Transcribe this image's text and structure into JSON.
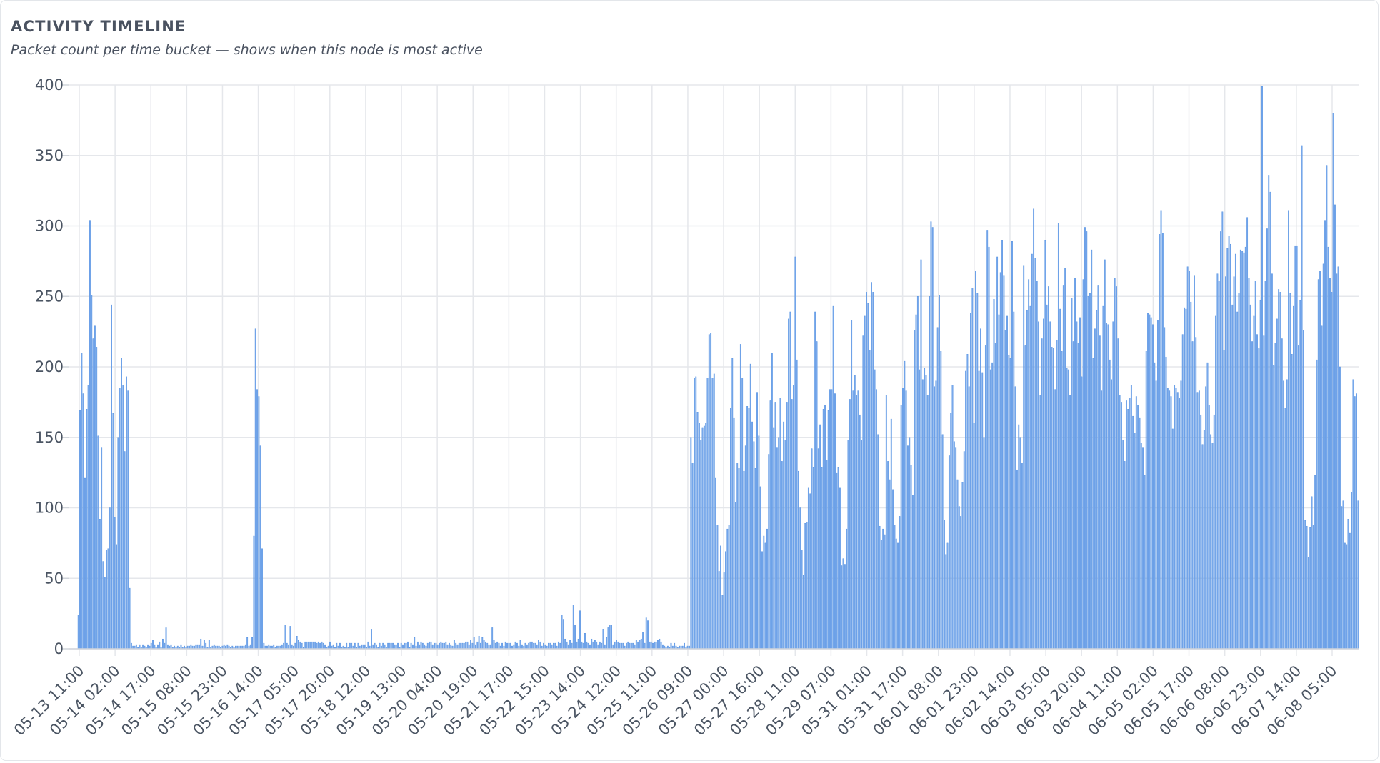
{
  "panel": {
    "title": "ACTIVITY TIMELINE",
    "subtitle": "Packet count per time bucket — shows when this node is most active"
  },
  "chart_data": {
    "type": "bar",
    "title": "ACTIVITY TIMELINE",
    "subtitle": "Packet count per time bucket — shows when this node is most active",
    "xlabel": "",
    "ylabel": "",
    "ylim": [
      0,
      400
    ],
    "yticks": [
      0,
      50,
      100,
      150,
      200,
      250,
      300,
      350,
      400
    ],
    "grid": true,
    "legend": "none",
    "bar_color": "#79a9eb",
    "bar_edge_color": "#4a8be0",
    "x_tick_labels": [
      "05-13 11:00",
      "05-14 02:00",
      "05-14 17:00",
      "05-15 08:00",
      "05-15 23:00",
      "05-16 14:00",
      "05-17 05:00",
      "05-17 20:00",
      "05-18 12:00",
      "05-19 13:00",
      "05-20 04:00",
      "05-20 19:00",
      "05-21 17:00",
      "05-22 15:00",
      "05-23 14:00",
      "05-24 12:00",
      "05-25 11:00",
      "05-26 09:00",
      "05-27 00:00",
      "05-27 16:00",
      "05-28 11:00",
      "05-29 07:00",
      "05-31 01:00",
      "05-31 17:00",
      "06-01 08:00",
      "06-01 23:00",
      "06-02 14:00",
      "06-03 05:00",
      "06-03 20:00",
      "06-04 11:00",
      "06-05 02:00",
      "06-05 17:00",
      "06-06 08:00",
      "06-06 23:00",
      "06-07 14:00",
      "06-08 05:00"
    ],
    "values": [
      24,
      169,
      210,
      181,
      121,
      170,
      187,
      304,
      251,
      220,
      229,
      214,
      151,
      92,
      143,
      62,
      51,
      70,
      71,
      100,
      244,
      167,
      93,
      74,
      150,
      185,
      206,
      187,
      140,
      193,
      183,
      43,
      4,
      2,
      2,
      3,
      1,
      3,
      1,
      3,
      2,
      1,
      3,
      2,
      4,
      6,
      3,
      1,
      3,
      5,
      1,
      7,
      4,
      15,
      3,
      2,
      3,
      1,
      2,
      1,
      2,
      1,
      3,
      1,
      2,
      1,
      2,
      2,
      3,
      2,
      2,
      3,
      3,
      3,
      7,
      2,
      6,
      4,
      1,
      6,
      1,
      2,
      3,
      2,
      2,
      2,
      1,
      2,
      3,
      2,
      3,
      2,
      1,
      2,
      1,
      2,
      2,
      2,
      2,
      2,
      2,
      3,
      8,
      2,
      3,
      8,
      80,
      227,
      184,
      179,
      144,
      71,
      4,
      2,
      2,
      3,
      2,
      2,
      3,
      1,
      2,
      2,
      2,
      3,
      4,
      17,
      4,
      3,
      16,
      3,
      2,
      4,
      9,
      6,
      5,
      4,
      1,
      5,
      5,
      5,
      5,
      5,
      5,
      5,
      4,
      5,
      4,
      5,
      4,
      3,
      1,
      2,
      5,
      2,
      3,
      1,
      4,
      2,
      4,
      1,
      2,
      1,
      4,
      1,
      4,
      4,
      2,
      4,
      1,
      4,
      2,
      3,
      3,
      3,
      1,
      5,
      2,
      14,
      3,
      4,
      3,
      1,
      4,
      2,
      4,
      3,
      1,
      4,
      4,
      4,
      4,
      3,
      3,
      4,
      1,
      4,
      3,
      4,
      4,
      5,
      1,
      4,
      3,
      8,
      2,
      5,
      3,
      5,
      4,
      3,
      2,
      4,
      5,
      5,
      3,
      4,
      4,
      3,
      4,
      5,
      4,
      4,
      5,
      3,
      4,
      3,
      2,
      6,
      4,
      3,
      4,
      4,
      4,
      4,
      5,
      5,
      3,
      6,
      4,
      8,
      3,
      5,
      9,
      4,
      8,
      6,
      5,
      4,
      3,
      3,
      15,
      6,
      4,
      5,
      4,
      2,
      4,
      2,
      5,
      4,
      4,
      4,
      2,
      3,
      5,
      4,
      2,
      6,
      3,
      2,
      4,
      3,
      4,
      5,
      5,
      4,
      4,
      3,
      6,
      5,
      2,
      4,
      3,
      2,
      4,
      4,
      3,
      4,
      4,
      2,
      5,
      4,
      24,
      21,
      7,
      5,
      3,
      6,
      4,
      31,
      17,
      5,
      7,
      27,
      5,
      4,
      11,
      5,
      4,
      3,
      7,
      5,
      6,
      5,
      3,
      5,
      4,
      14,
      3,
      8,
      15,
      17,
      17,
      3,
      5,
      6,
      5,
      4,
      4,
      4,
      2,
      4,
      5,
      4,
      4,
      4,
      3,
      6,
      5,
      6,
      7,
      12,
      4,
      22,
      20,
      5,
      5,
      4,
      5,
      5,
      6,
      7,
      5,
      3,
      2,
      1,
      2,
      1,
      4,
      2,
      4,
      2,
      1,
      2,
      2,
      2,
      4,
      1,
      2,
      2,
      150,
      132,
      192,
      193,
      168,
      160,
      148,
      157,
      158,
      160,
      192,
      223,
      224,
      192,
      195,
      121,
      88,
      55,
      73,
      38,
      54,
      69,
      85,
      88,
      171,
      206,
      164,
      104,
      132,
      128,
      216,
      192,
      126,
      144,
      172,
      171,
      202,
      161,
      147,
      128,
      182,
      151,
      115,
      69,
      80,
      75,
      85,
      138,
      176,
      210,
      157,
      175,
      143,
      150,
      178,
      133,
      161,
      148,
      175,
      234,
      239,
      177,
      187,
      278,
      205,
      126,
      100,
      70,
      52,
      89,
      90,
      114,
      110,
      142,
      129,
      239,
      218,
      142,
      159,
      129,
      170,
      173,
      134,
      169,
      184,
      184,
      243,
      181,
      125,
      129,
      114,
      59,
      64,
      60,
      85,
      148,
      177,
      233,
      183,
      194,
      180,
      183,
      166,
      148,
      222,
      236,
      253,
      245,
      212,
      260,
      253,
      198,
      184,
      152,
      87,
      77,
      85,
      81,
      180,
      133,
      120,
      163,
      113,
      88,
      78,
      75,
      94,
      173,
      185,
      204,
      183,
      144,
      150,
      130,
      109,
      226,
      237,
      250,
      198,
      276,
      191,
      199,
      194,
      180,
      250,
      303,
      299,
      186,
      190,
      228,
      251,
      211,
      152,
      91,
      67,
      75,
      137,
      167,
      187,
      147,
      143,
      120,
      101,
      94,
      118,
      140,
      197,
      209,
      186,
      238,
      256,
      160,
      268,
      252,
      197,
      227,
      196,
      150,
      215,
      297,
      285,
      198,
      203,
      248,
      217,
      278,
      237,
      267,
      290,
      265,
      226,
      236,
      208,
      206,
      289,
      239,
      186,
      127,
      159,
      150,
      132,
      272,
      215,
      240,
      262,
      243,
      280,
      312,
      277,
      261,
      232,
      180,
      220,
      234,
      290,
      244,
      257,
      232,
      214,
      213,
      184,
      219,
      302,
      241,
      211,
      258,
      270,
      199,
      198,
      180,
      249,
      218,
      263,
      232,
      217,
      235,
      193,
      262,
      299,
      296,
      250,
      252,
      283,
      206,
      227,
      240,
      258,
      222,
      183,
      243,
      276,
      231,
      230,
      205,
      191,
      232,
      263,
      257,
      220,
      180,
      175,
      148,
      133,
      176,
      170,
      178,
      187,
      165,
      153,
      179,
      173,
      164,
      146,
      143,
      123,
      211,
      238,
      237,
      235,
      230,
      203,
      190,
      233,
      294,
      311,
      295,
      228,
      207,
      185,
      183,
      179,
      156,
      187,
      185,
      182,
      178,
      190,
      223,
      242,
      241,
      271,
      268,
      246,
      218,
      265,
      221,
      182,
      183,
      166,
      145,
      155,
      186,
      203,
      173,
      152,
      146,
      166,
      236,
      266,
      261,
      296,
      310,
      212,
      264,
      284,
      293,
      287,
      244,
      264,
      280,
      239,
      252,
      283,
      282,
      281,
      285,
      306,
      263,
      244,
      218,
      236,
      261,
      223,
      213,
      247,
      399,
      222,
      261,
      298,
      336,
      324,
      266,
      201,
      217,
      234,
      255,
      253,
      220,
      190,
      171,
      191,
      311,
      252,
      209,
      243,
      286,
      286,
      215,
      247,
      357,
      226,
      91,
      87,
      65,
      86,
      108,
      88,
      123,
      205,
      262,
      268,
      229,
      273,
      304,
      343,
      285,
      263,
      253,
      380,
      315,
      266,
      271,
      200,
      101,
      105,
      75,
      74,
      92,
      82,
      111,
      191,
      179,
      181,
      105
    ]
  }
}
